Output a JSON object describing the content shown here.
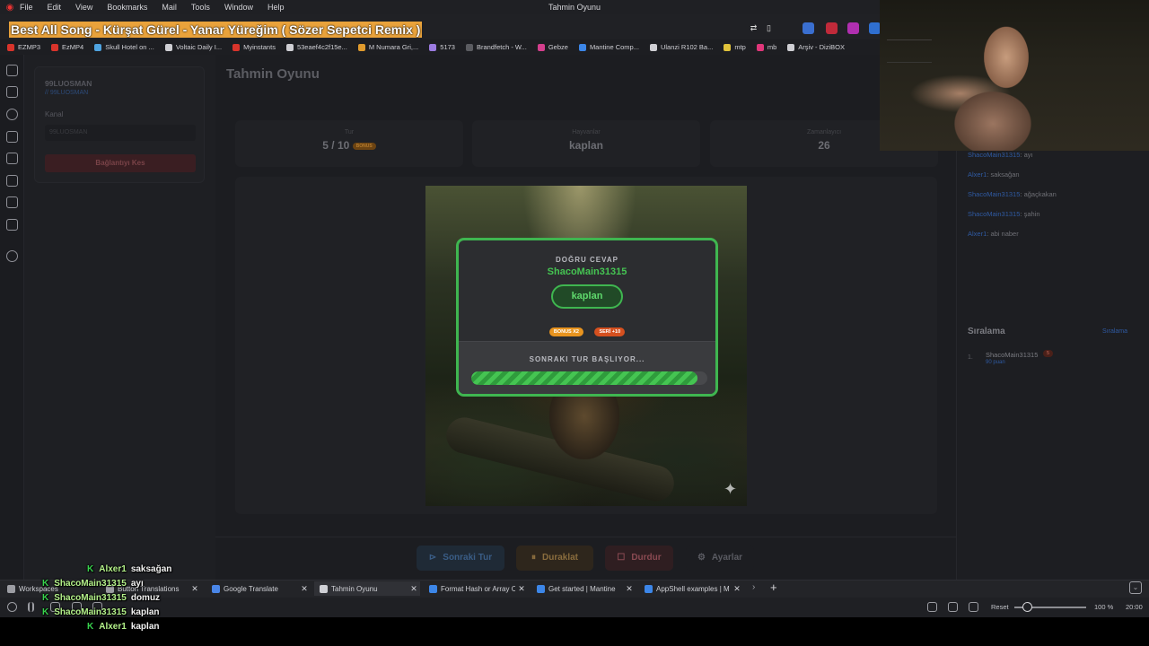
{
  "menubar": {
    "items": [
      "File",
      "Edit",
      "View",
      "Bookmarks",
      "Mail",
      "Tools",
      "Window",
      "Help"
    ],
    "window_title": "Tahmin Oyunu"
  },
  "now_playing": "Best All Song - Kürşat Gürel - Yanar Yüreğim ( Sözer Sepetci Remix )",
  "bookmarks": [
    {
      "label": "EZMP3",
      "color": "#d9342b"
    },
    {
      "label": "EzMP4",
      "color": "#d9342b"
    },
    {
      "label": "Skull Hotel on ...",
      "color": "#4fa3e0"
    },
    {
      "label": "Voltaic Daily I...",
      "color": "#cfcfd4"
    },
    {
      "label": "Myinstants",
      "color": "#d9342b"
    },
    {
      "label": "53eaef4c2f15e...",
      "color": "#cfcfd4"
    },
    {
      "label": "M Numara Gri,...",
      "color": "#e09b2d"
    },
    {
      "label": "5173",
      "color": "#9b7be0"
    },
    {
      "label": "Brandfetch - W...",
      "color": "#5b5c61"
    },
    {
      "label": "Gebze",
      "color": "#d43f8d"
    },
    {
      "label": "Mantine Comp...",
      "color": "#3c86e8"
    },
    {
      "label": "Ulanzi R102 Ba...",
      "color": "#cfcfd4"
    },
    {
      "label": "mtp",
      "color": "#e0c23b"
    },
    {
      "label": "mb",
      "color": "#e0367a"
    },
    {
      "label": "Arşiv - DiziBOX",
      "color": "#cfcfd4"
    }
  ],
  "connection": {
    "username": "99LUOSMAN",
    "handle": "// 99LUOSMAN",
    "channel_label": "Kanal",
    "channel_value": "99LUOSMAN",
    "disconnect_label": "Bağlantıyı Kes"
  },
  "game": {
    "title": "Tahmin Oyunu",
    "stats": [
      {
        "label": "Tur",
        "value": "5 / 10",
        "badge": "BONUS"
      },
      {
        "label": "Hayvanlar",
        "value": "kaplan"
      },
      {
        "label": "Zamanlayıcı",
        "value": "26"
      }
    ]
  },
  "result": {
    "title": "DOĞRU CEVAP",
    "winner": "ShacoMain31315",
    "answer": "kaplan",
    "badges": [
      {
        "label": "BONUS X2",
        "color": "#e8941f"
      },
      {
        "label": "SERİ +10",
        "color": "#d5501f"
      }
    ],
    "next_label": "SONRAKI TUR BAŞLIYOR...",
    "progress": 0.96
  },
  "controls": [
    {
      "label": "Sonraki Tur",
      "icon": "skip-icon",
      "glyph": "⊳",
      "bg": "#1f2a36",
      "color": "#3a5d86"
    },
    {
      "label": "Duraklat",
      "icon": "pause-icon",
      "glyph": "⏸",
      "bg": "#2e261c",
      "color": "#8a6d3e"
    },
    {
      "label": "Durdur",
      "icon": "stop-icon",
      "glyph": "☐",
      "bg": "#2f1e21",
      "color": "#8a4a52"
    },
    {
      "label": "Ayarlar",
      "icon": "gear-icon",
      "glyph": "⚙",
      "bg": "#1c1d21",
      "color": "#5a5b62"
    }
  ],
  "chat_panel": [
    {
      "user": "ShacoMain31315",
      "message": "ayı"
    },
    {
      "user": "Alxer1",
      "message": "saksağan"
    },
    {
      "user": "ShacoMain31315",
      "message": "ağaçkakan"
    },
    {
      "user": "ShacoMain31315",
      "message": "şahin"
    },
    {
      "user": "Alxer1",
      "message": "abi naber"
    }
  ],
  "ranking": {
    "title": "Sıralama",
    "link": "Sıralama",
    "rows": [
      {
        "rank": "1.",
        "name": "ShacoMain31315",
        "points": "90 puan",
        "badge": "5"
      }
    ]
  },
  "tabs": [
    {
      "label": "Workspaces",
      "color": "#9c9da3"
    },
    {
      "label": "Button Translations",
      "color": "#9c9da3"
    },
    {
      "label": "Google Translate",
      "color": "#4a86e8"
    },
    {
      "label": "Tahmin Oyunu",
      "color": "#cfd0d5"
    },
    {
      "label": "Format Hash or Array C",
      "color": "#3c86e8"
    },
    {
      "label": "Get started | Mantine",
      "color": "#3c86e8"
    },
    {
      "label": "AppShell examples | M",
      "color": "#3c86e8"
    }
  ],
  "status": {
    "reset_label": "Reset",
    "zoom": "100 %",
    "zoom_level": 0.17,
    "time": "20:00"
  },
  "overlay_chat": [
    {
      "user": "Alxer1",
      "message": "saksağan"
    },
    {
      "user": "ShacoMain31315",
      "message": "ayı"
    },
    {
      "user": "ShacoMain31315",
      "message": "domuz"
    },
    {
      "user": "ShacoMain31315",
      "message": "kaplan"
    },
    {
      "user": "Alxer1",
      "message": "kaplan"
    }
  ],
  "colors": {
    "accent_green": "#3fb650",
    "link_blue": "#2f5aa2",
    "now_playing_bg": "#e9a23b"
  }
}
